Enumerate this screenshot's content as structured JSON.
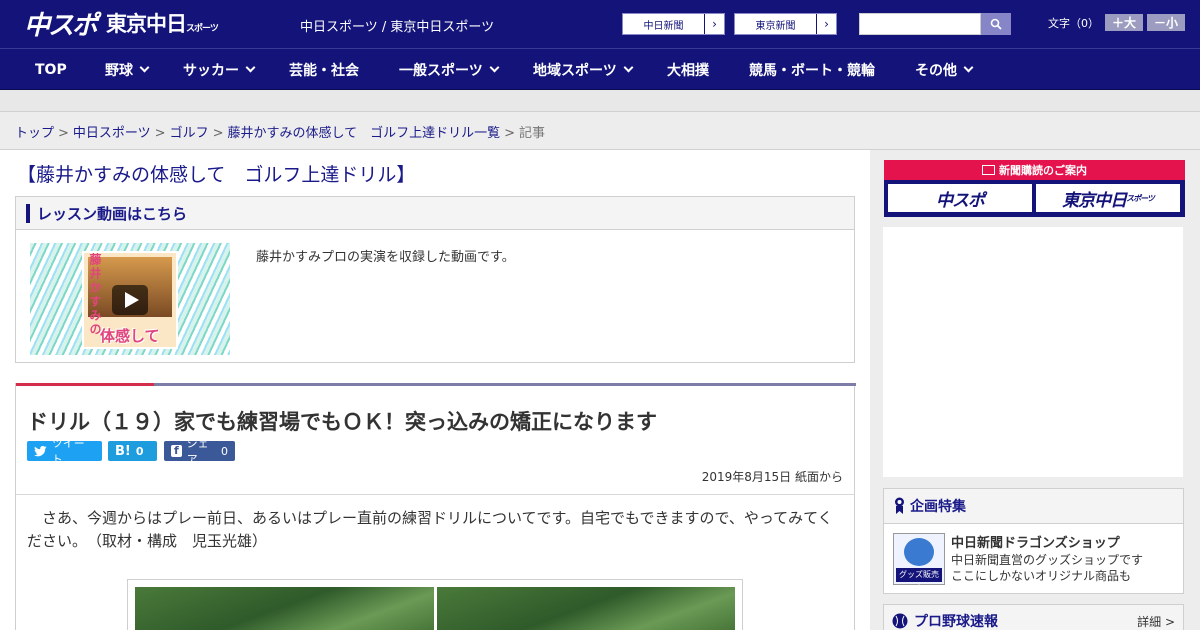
{
  "header": {
    "logo_main": "中スポ",
    "logo_sub": "東京中日",
    "logo_sub_small": "スポーツ",
    "site_names": "中日スポーツ / 東京中日スポーツ",
    "links": [
      {
        "label": "中日新聞"
      },
      {
        "label": "東京新聞"
      }
    ],
    "search_placeholder": "",
    "font_size_label": "文字（0）",
    "font_plus": "＋大",
    "font_minus": "－小"
  },
  "nav": {
    "items": [
      {
        "label": "TOP"
      },
      {
        "label": "野球"
      },
      {
        "label": "サッカー"
      },
      {
        "label": "芸能・社会"
      },
      {
        "label": "一般スポーツ"
      },
      {
        "label": "地域スポーツ"
      },
      {
        "label": "大相撲"
      },
      {
        "label": "競馬・ボート・競輪"
      },
      {
        "label": "その他"
      }
    ]
  },
  "breadcrumb": {
    "items": [
      "トップ",
      "中日スポーツ",
      "ゴルフ",
      "藤井かすみの体感して　ゴルフ上達ドリル一覧"
    ],
    "current": "記事",
    "separator": ">"
  },
  "main": {
    "page_title": "【藤井かすみの体感して　ゴルフ上達ドリル】",
    "lesson": {
      "heading": "レッスン動画はこちら",
      "thumb_vertical_text": "藤井かすみの",
      "thumb_title": "体感して",
      "description": "藤井かすみプロの実演を収録した動画です。"
    },
    "article": {
      "title": "ドリル（１９）家でも練習場でもＯＫ！突っ込みの矯正になります",
      "share": {
        "tweet": "ツイート",
        "hatena": "B!",
        "hatena_count": "0",
        "facebook": "シェア",
        "facebook_count": "0"
      },
      "date": "2019年8月15日 紙面から",
      "body": "　さあ、今週からはプレー前日、あるいはプレー直前の練習ドリルについてです。自宅でもできますので、やってみてください。　（取材・構成　児玉光雄）"
    }
  },
  "sidebar": {
    "subscription": {
      "caption": "新聞購読のご案内",
      "left": "中スポ",
      "right": "東京中日",
      "right_small": "スポーツ"
    },
    "feature": {
      "heading": "企画特集",
      "shop_name": "中日新聞ドラゴンズショップ",
      "shop_desc_1": "中日新聞直営のグッズショップです",
      "shop_desc_2": "ここにしかないオリジナル商品も",
      "shop_thumb_label": "グッズ販売中"
    },
    "baseball": {
      "heading": "プロ野球速報",
      "more": "詳細 >"
    }
  },
  "colors": {
    "brand_navy": "#13137a",
    "accent_red": "#e4134d",
    "twitter": "#1da1f2",
    "hatena": "#1d9cde",
    "facebook": "#3b5998"
  }
}
